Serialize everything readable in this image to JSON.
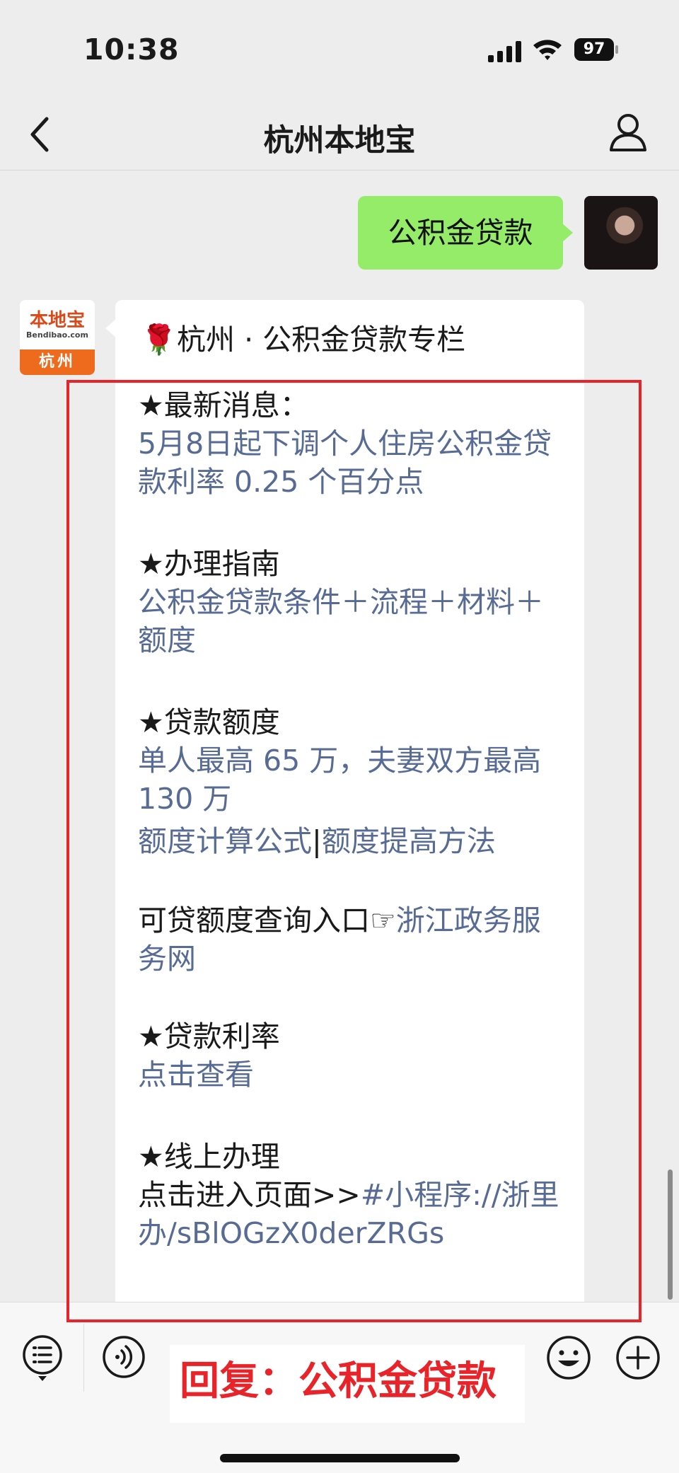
{
  "status": {
    "time": "10:38",
    "battery": "97"
  },
  "nav": {
    "title": "杭州本地宝"
  },
  "chat": {
    "my_message": "公积金贷款",
    "bot_logo": {
      "brand": "本地宝",
      "url": "Bendibao.com",
      "city": "杭州"
    },
    "card": {
      "title": "🌹杭州 · 公积金贷款专栏",
      "s1_head": "★最新消息：",
      "s1_body": "5月8日起下调个人住房公积金贷款利率 0.25 个百分点",
      "s2_head": "★办理指南",
      "s2_body": "公积金贷款条件＋流程＋材料＋额度",
      "s3_head": "★贷款额度",
      "s3_body": "单人最高 65 万，夫妻双方最高 130 万",
      "s4_link1": "额度计算公式",
      "s4_sep": "|",
      "s4_link2": "额度提高方法",
      "s5_text": "可贷额度查询入口☞",
      "s5_link": "浙江政务服务网",
      "s6_head": "★贷款利率",
      "s6_body": "点击查看",
      "s7_head": "★线上办理",
      "s7_text": "点击进入页面>>",
      "s7_link": "#小程序://浙里办/sBlOGzX0derZRGs"
    }
  },
  "bottom": {
    "reply_hint": "回复：公积金贷款"
  }
}
